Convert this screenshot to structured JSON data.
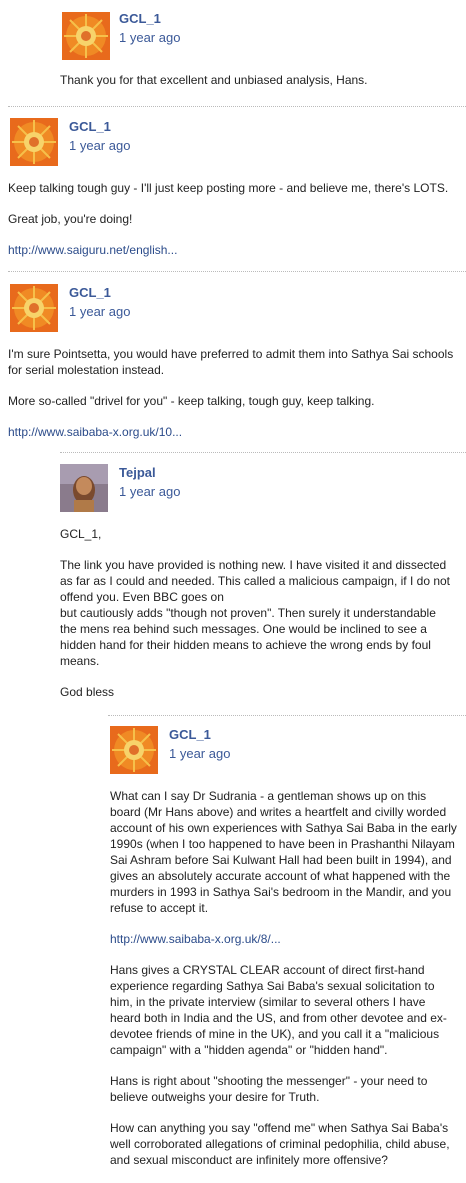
{
  "comments": [
    {
      "author": "GCL_1",
      "time": "1 year ago",
      "paragraphs": [
        "Thank you for that excellent and unbiased analysis, Hans."
      ]
    },
    {
      "author": "GCL_1",
      "time": "1 year ago",
      "paragraphs": [
        "Keep talking tough guy - I'll just keep posting more - and believe me, there's LOTS.",
        "Great job, you're doing!"
      ],
      "link": "http://www.saiguru.net/english..."
    },
    {
      "author": "GCL_1",
      "time": "1 year ago",
      "paragraphs": [
        "I'm sure Pointsetta, you would have preferred to admit them into Sathya Sai schools for serial molestation instead.",
        "More so-called \"drivel for you\" - keep talking, tough guy, keep talking."
      ],
      "link": "http://www.saibaba-x.org.uk/10..."
    },
    {
      "author": "Tejpal",
      "time": "1 year ago",
      "paragraphs": [
        "GCL_1,",
        "The link you have provided is nothing new. I have visited it and dissected as far as I could and needed. This called a malicious campaign, if I do not offend you. Even BBC goes on\nbut cautiously adds \"though not proven\". Then surely it understandable the mens rea behind such messages. One would be inclined to see a hidden hand for their hidden means to achieve the wrong ends by foul means.",
        "God bless"
      ]
    },
    {
      "author": "GCL_1",
      "time": "1 year ago",
      "paragraphs": [
        "What can I say Dr Sudrania - a gentleman shows up on this board (Mr Hans above) and writes a heartfelt and civilly worded account of his own experiences with Sathya Sai Baba in the early 1990s (when I too happened to have been in Prashanthi Nilayam Sai Ashram before Sai Kulwant Hall had been built in 1994), and gives an absolutely accurate account of what happened with the murders in 1993 in Sathya Sai's bedroom in the Mandir, and you refuse to accept it."
      ],
      "link": "http://www.saibaba-x.org.uk/8/...",
      "paragraphs_after": [
        "Hans gives a CRYSTAL CLEAR account of direct first-hand experience regarding Sathya Sai Baba's sexual solicitation to him, in the private interview (similar to several others I have heard both in India and the US, and from other devotee and ex-devotee friends of mine in the UK), and you call it a \"malicious campaign\" with a \"hidden agenda\" or \"hidden hand\".",
        "Hans is right about \"shooting the messenger\" - your need to believe outweighs your desire for Truth.",
        "How can anything you say \"offend me\" when Sathya Sai Baba's well corroborated allegations of criminal pedophilia, child abuse, and sexual misconduct are infinitely more offensive?"
      ]
    }
  ],
  "colors": {
    "link": "#3b5998",
    "separator": "#bbbbbb"
  },
  "icons": {
    "gcl_avatar": "sun-avatar-icon",
    "tejpal_avatar": "portrait-avatar-icon"
  }
}
